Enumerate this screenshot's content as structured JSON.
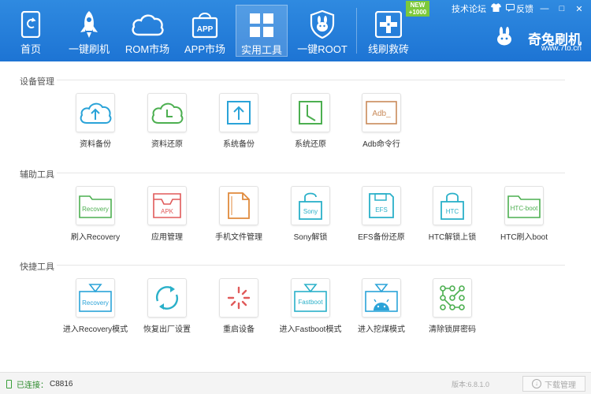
{
  "nav": {
    "items": [
      {
        "label": "首页",
        "icon": "home-icon"
      },
      {
        "label": "一键刷机",
        "icon": "rocket-icon"
      },
      {
        "label": "ROM市场",
        "icon": "cloud-icon"
      },
      {
        "label": "APP市场",
        "icon": "shopping-bag-icon",
        "icon_text": "APP"
      },
      {
        "label": "实用工具",
        "icon": "grid-icon",
        "active": true
      },
      {
        "label": "一键ROOT",
        "icon": "shield-bunny-icon"
      },
      {
        "label": "线刷救砖",
        "icon": "rescue-icon"
      }
    ],
    "new_badge": {
      "line1": "NEW",
      "line2": "+1000"
    }
  },
  "top_links": {
    "forum": "技术论坛",
    "feedback": "反馈"
  },
  "window_controls": {
    "minimize": "—",
    "maximize": "□",
    "close": "✕"
  },
  "brand": {
    "name": "奇兔刷机",
    "url": "www.7to.cn"
  },
  "sections": [
    {
      "title": "设备管理",
      "tools": [
        {
          "label": "资料备份",
          "icon": "cloud-upload-icon"
        },
        {
          "label": "资料还原",
          "icon": "cloud-clock-icon"
        },
        {
          "label": "系统备份",
          "icon": "system-backup-icon"
        },
        {
          "label": "系统还原",
          "icon": "system-restore-icon"
        },
        {
          "label": "Adb命令行",
          "icon": "adb-terminal-icon",
          "icon_text": "Adb_"
        }
      ]
    },
    {
      "title": "辅助工具",
      "tools": [
        {
          "label": "刷入Recovery",
          "icon": "recovery-folder-icon",
          "icon_text": "Recovery"
        },
        {
          "label": "应用管理",
          "icon": "apk-box-icon",
          "icon_text": "APK"
        },
        {
          "label": "手机文件管理",
          "icon": "file-icon"
        },
        {
          "label": "Sony解锁",
          "icon": "sony-unlock-icon",
          "icon_text": "Sony"
        },
        {
          "label": "EFS备份还原",
          "icon": "efs-disk-icon",
          "icon_text": "EFS"
        },
        {
          "label": "HTC解锁上锁",
          "icon": "htc-lock-icon",
          "icon_text": "HTC"
        },
        {
          "label": "HTC刷入boot",
          "icon": "htc-boot-folder-icon",
          "icon_text": "HTC-boot"
        }
      ]
    },
    {
      "title": "快捷工具",
      "tools": [
        {
          "label": "进入Recovery模式",
          "icon": "enter-recovery-icon",
          "icon_text": "Recovery"
        },
        {
          "label": "恢复出厂设置",
          "icon": "factory-reset-icon"
        },
        {
          "label": "重启设备",
          "icon": "reboot-spinner-icon"
        },
        {
          "label": "进入Fastboot模式",
          "icon": "enter-fastboot-icon",
          "icon_text": "Fastboot"
        },
        {
          "label": "进入挖煤模式",
          "icon": "android-download-icon"
        },
        {
          "label": "清除锁屏密码",
          "icon": "pattern-lock-icon"
        }
      ]
    }
  ],
  "status": {
    "connected_label": "已连接：",
    "device": "C8816",
    "version": "版本:6.8.1.0",
    "download_manager": "下载管理"
  },
  "colors": {
    "topbar": "#2280dc",
    "accent_blue": "#2aa3d8",
    "green": "#4caf50",
    "red": "#e05a5a",
    "orange": "#e08a3c",
    "teal": "#2ab0c9"
  }
}
